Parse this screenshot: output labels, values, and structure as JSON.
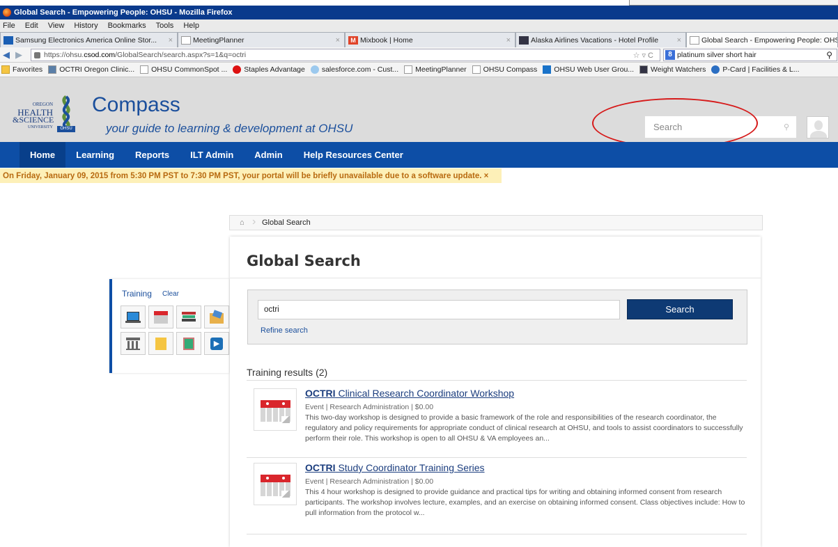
{
  "window": {
    "title": "Global Search - Empowering People: OHSU - Mozilla Firefox"
  },
  "menu": [
    "File",
    "Edit",
    "View",
    "History",
    "Bookmarks",
    "Tools",
    "Help"
  ],
  "tabs": [
    {
      "label": "Samsung Electronics America Online Stor..."
    },
    {
      "label": "MeetingPlanner"
    },
    {
      "label": "Mixbook | Home"
    },
    {
      "label": "Alaska Airlines Vacations - Hotel Profile"
    },
    {
      "label": "Global Search - Empowering People: OHSU"
    }
  ],
  "url": {
    "prefix": "https://ohsu.",
    "domain": "csod.com",
    "path": "/GlobalSearch/search.aspx?s=1&q=octri"
  },
  "websearch": {
    "value": "platinum silver short hair",
    "engine_glyph": "8"
  },
  "favorites": [
    {
      "label": "Favorites"
    },
    {
      "label": "OCTRI Oregon Clinic..."
    },
    {
      "label": "OHSU CommonSpot ..."
    },
    {
      "label": "Staples Advantage"
    },
    {
      "label": "salesforce.com - Cust..."
    },
    {
      "label": "MeetingPlanner"
    },
    {
      "label": "OHSU Compass"
    },
    {
      "label": "OHSU Web User Grou..."
    },
    {
      "label": "Weight Watchers"
    },
    {
      "label": "P-Card | Facilities & L..."
    }
  ],
  "header": {
    "logo_lines": [
      "OREGON",
      "HEALTH",
      "&SCIENCE",
      "UNIVERSITY"
    ],
    "logo_badge": "OHSU",
    "title": "Compass",
    "subtitle": "your guide to learning & development at OHSU",
    "search_placeholder": "Search"
  },
  "nav": [
    "Home",
    "Learning",
    "Reports",
    "ILT Admin",
    "Admin",
    "Help Resources Center"
  ],
  "alert": "On Friday, January 09, 2015 from 5:30 PM PST to 7:30 PM PST, your portal will be briefly unavailable due to a software update. ×",
  "breadcrumb": {
    "current": "Global Search"
  },
  "panel": {
    "title": "Global Search",
    "query": "octri",
    "search_button": "Search",
    "refine": "Refine search",
    "results_heading": "Training results (2)"
  },
  "sidebar": {
    "title": "Training",
    "clear": "Clear"
  },
  "results": [
    {
      "keyword": "OCTRI",
      "title_rest": " Clinical Research Coordinator Workshop",
      "meta": "Event  |  Research Administration  |  $0.00",
      "desc": "This two-day workshop is designed to provide a basic framework of the role and responsibilities of the research coordinator, the regulatory and policy requirements for appropriate conduct of clinical research at OHSU, and tools to assist coordinators to successfully perform their role. This workshop is open to all OHSU & VA employees an..."
    },
    {
      "keyword": "OCTRI",
      "title_rest": " Study Coordinator Training Series",
      "meta": "Event  |  Research Administration  |  $0.00",
      "desc": "This 4 hour workshop is designed to provide guidance and practical tips for writing and obtaining informed consent from research participants.   The workshop involves lecture, examples, and an exercise on obtaining informed consent. Class objectives include: How to pull information from the protocol w..."
    }
  ]
}
